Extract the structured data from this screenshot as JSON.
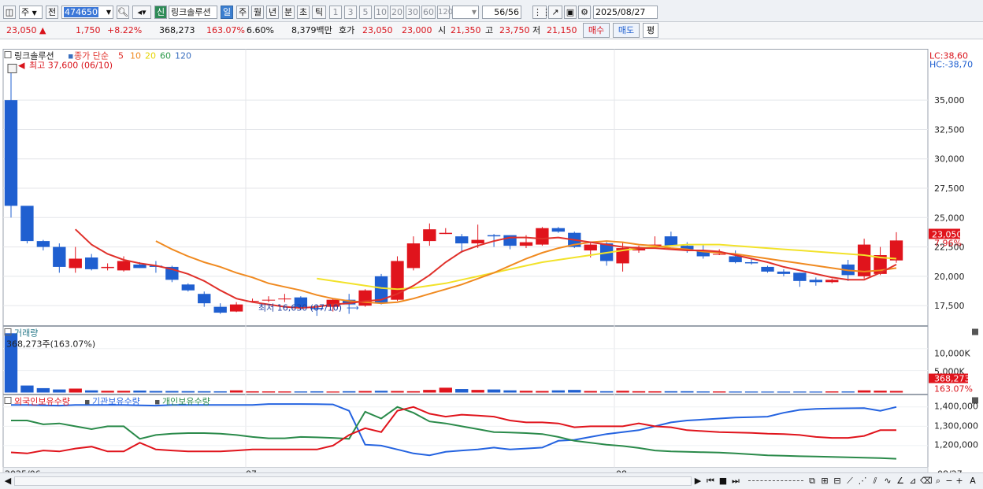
{
  "toolbar": {
    "market": "주",
    "prev_label": "전",
    "code": "474650",
    "new_badge": "신",
    "name": "링크솔루션",
    "periods": [
      "일",
      "주",
      "월",
      "년",
      "분",
      "초",
      "틱"
    ],
    "intervals": [
      "1",
      "3",
      "5",
      "10",
      "20",
      "30",
      "60",
      "120"
    ],
    "count": "56",
    "count_total": "/56",
    "date": "2025/08/27"
  },
  "quote": {
    "price": "23,050",
    "change": "1,750",
    "change_pct": "+8.22%",
    "volume": "368,273",
    "vol_ratio": "163.07%",
    "turnover": "6.60%",
    "amount": "8,379백만",
    "hoga_label": "호가",
    "ask": "23,050",
    "bid": "23,000",
    "open_label": "시",
    "open": "21,350",
    "high_label": "고",
    "high": "23,750",
    "low_label": "저",
    "low": "21,150",
    "buy_label": "매수",
    "sell_label": "매도",
    "eval_label": "평"
  },
  "price_panel": {
    "legend_name": "링크솔루션",
    "ma_legend": "종가 단순",
    "ma_periods": [
      "5",
      "10",
      "20",
      "60",
      "120"
    ],
    "ma_colors": [
      "#e0302a",
      "#f08a20",
      "#f2e22a",
      "#2d9a4a",
      "#3a6fbf"
    ],
    "lc": "LC:38,60",
    "hc": "HC:-38,70",
    "high_note": "최고 37,600 (06/10)",
    "low_note": "최저 16,630 (07/10)",
    "last_price": "23,050",
    "last_pct": "7.96%",
    "yticks": [
      "35,000",
      "32,500",
      "30,000",
      "27,500",
      "25,000",
      "22,500",
      "20,000",
      "17,500"
    ]
  },
  "volume_panel": {
    "title": "거래량",
    "info": "368,273주(163.07%)",
    "yticks": [
      "10,000K",
      "5,000K"
    ],
    "last_value": "368,273",
    "last_pct": "163.07%"
  },
  "holding_panel": {
    "series_labels": [
      "외국인보유수량",
      "기관보유수량",
      "개인보유수량"
    ],
    "series_colors": [
      "#e0141c",
      "#2463e0",
      "#2a8a4a"
    ],
    "yticks": [
      "1,400,000",
      "1,300,000",
      "1,200,000"
    ]
  },
  "xaxis": {
    "labels": [
      "2025/06",
      "07",
      "08"
    ],
    "right_label": "08/27"
  },
  "chart_data": {
    "type": "candlestick",
    "candles": [
      [
        35000,
        37600,
        25000,
        26000
      ],
      [
        26000,
        25800,
        22800,
        23000
      ],
      [
        23000,
        23100,
        22200,
        22500
      ],
      [
        22500,
        22800,
        20300,
        20800
      ],
      [
        20700,
        22500,
        20300,
        21500
      ],
      [
        21600,
        21900,
        20500,
        20600
      ],
      [
        20700,
        21100,
        20500,
        20800
      ],
      [
        20500,
        21700,
        20400,
        21300
      ],
      [
        21000,
        21200,
        20700,
        20700
      ],
      [
        20900,
        21300,
        20300,
        20800
      ],
      [
        20800,
        20900,
        19500,
        19700
      ],
      [
        19300,
        19400,
        18700,
        18800
      ],
      [
        18500,
        18700,
        17400,
        17700
      ],
      [
        17400,
        17700,
        16800,
        16900
      ],
      [
        17000,
        17800,
        16950,
        17600
      ],
      [
        17900,
        18100,
        17800,
        17900
      ],
      [
        18000,
        18300,
        17800,
        18000
      ],
      [
        18100,
        18500,
        17800,
        18100
      ],
      [
        18200,
        18300,
        17100,
        17300
      ],
      [
        17300,
        17600,
        16630,
        17200
      ],
      [
        17400,
        18100,
        17000,
        18000
      ],
      [
        18000,
        18500,
        16800,
        17600
      ],
      [
        17500,
        18900,
        17400,
        18800
      ],
      [
        20000,
        20200,
        17600,
        17700
      ],
      [
        18000,
        21700,
        17900,
        21300
      ],
      [
        20700,
        23400,
        20500,
        22800
      ],
      [
        23000,
        24500,
        22600,
        24000
      ],
      [
        23600,
        24100,
        23600,
        23700
      ],
      [
        23400,
        23600,
        22000,
        22800
      ],
      [
        22800,
        24400,
        22400,
        23100
      ],
      [
        23500,
        23600,
        22500,
        23400
      ],
      [
        23500,
        23400,
        22300,
        22600
      ],
      [
        22600,
        23500,
        22400,
        22900
      ],
      [
        22700,
        24200,
        22600,
        24100
      ],
      [
        24100,
        24200,
        23700,
        23800
      ],
      [
        23700,
        23800,
        22400,
        22500
      ],
      [
        22200,
        22900,
        21600,
        22700
      ],
      [
        22800,
        22900,
        20900,
        21300
      ],
      [
        21100,
        22900,
        20400,
        22400
      ],
      [
        22200,
        22600,
        22000,
        22500
      ],
      [
        22600,
        23400,
        22400,
        22700
      ],
      [
        23400,
        23800,
        22600,
        22600
      ],
      [
        22600,
        22900,
        22000,
        22300
      ],
      [
        22200,
        22700,
        21500,
        21700
      ],
      [
        21900,
        22300,
        21800,
        21900
      ],
      [
        21700,
        22200,
        21100,
        21200
      ],
      [
        21200,
        21500,
        21000,
        21100
      ],
      [
        20800,
        20900,
        20300,
        20400
      ],
      [
        20400,
        20600,
        20000,
        20200
      ],
      [
        20300,
        20300,
        19100,
        19600
      ],
      [
        19700,
        19900,
        19200,
        19500
      ],
      [
        19500,
        19800,
        19400,
        19700
      ],
      [
        21000,
        21400,
        19600,
        20100
      ],
      [
        20000,
        23200,
        19800,
        22700
      ],
      [
        20200,
        22500,
        20100,
        21800
      ],
      [
        21350,
        23750,
        21150,
        23050
      ]
    ],
    "ma5": [
      null,
      null,
      null,
      null,
      24000,
      22700,
      21900,
      21400,
      21100,
      20900,
      20600,
      20200,
      19600,
      18800,
      18100,
      17800,
      17600,
      17400,
      17300,
      17400,
      17600,
      17700,
      17900,
      18000,
      18500,
      19200,
      20100,
      21200,
      22100,
      22600,
      23000,
      23300,
      23300,
      23200,
      23300,
      23100,
      22900,
      22700,
      22500,
      22400,
      22400,
      22300,
      22200,
      22200,
      22100,
      21800,
      21500,
      21200,
      20800,
      20500,
      20200,
      19900,
      19700,
      19700,
      20300,
      21000
    ],
    "ma10": [
      null,
      null,
      null,
      null,
      null,
      null,
      null,
      null,
      null,
      23000,
      22300,
      21700,
      21200,
      20800,
      20300,
      19900,
      19400,
      19100,
      18800,
      18400,
      18100,
      17900,
      17800,
      17700,
      17800,
      18100,
      18500,
      18900,
      19300,
      19800,
      20300,
      20900,
      21500,
      22000,
      22400,
      22700,
      22900,
      23000,
      22900,
      22700,
      22600,
      22400,
      22300,
      22100,
      22000,
      21900,
      21700,
      21500,
      21300,
      21100,
      20900,
      20700,
      20500,
      20400,
      20500,
      20700
    ],
    "ma20": [
      null,
      null,
      null,
      null,
      null,
      null,
      null,
      null,
      null,
      null,
      null,
      null,
      null,
      null,
      null,
      null,
      null,
      null,
      null,
      19800,
      19600,
      19400,
      19200,
      19000,
      18900,
      19000,
      19200,
      19400,
      19700,
      20000,
      20300,
      20600,
      20900,
      21200,
      21400,
      21600,
      21800,
      22000,
      22200,
      22400,
      22500,
      22600,
      22700,
      22700,
      22700,
      22600,
      22500,
      22400,
      22300,
      22200,
      22100,
      22000,
      21900,
      21800,
      21600,
      21500
    ],
    "volume_k": [
      13500,
      1600,
      1000,
      700,
      900,
      500,
      400,
      400,
      450,
      350,
      350,
      320,
      300,
      280,
      500,
      280,
      260,
      250,
      250,
      280,
      230,
      300,
      350,
      400,
      350,
      300,
      600,
      1100,
      800,
      600,
      700,
      500,
      400,
      350,
      500,
      600,
      350,
      300,
      400,
      300,
      280,
      300,
      300,
      250,
      250,
      230,
      230,
      220,
      220,
      230,
      220,
      260,
      250,
      500,
      420,
      368
    ],
    "foreign": [
      1165000,
      1160000,
      1175000,
      1170000,
      1185000,
      1195000,
      1170000,
      1170000,
      1215000,
      1180000,
      1175000,
      1170000,
      1170000,
      1170000,
      1175000,
      1180000,
      1180000,
      1180000,
      1180000,
      1180000,
      1200000,
      1255000,
      1290000,
      1270000,
      1380000,
      1400000,
      1365000,
      1350000,
      1360000,
      1355000,
      1350000,
      1330000,
      1320000,
      1320000,
      1315000,
      1295000,
      1300000,
      1300000,
      1300000,
      1315000,
      1300000,
      1295000,
      1280000,
      1275000,
      1270000,
      1268000,
      1266000,
      1262000,
      1260000,
      1255000,
      1245000,
      1240000,
      1240000,
      1250000,
      1280000,
      1280000
    ],
    "institution": [
      1410000,
      1410000,
      1408000,
      1407000,
      1410000,
      1410000,
      1410000,
      1410000,
      1408000,
      1407000,
      1410000,
      1410000,
      1410000,
      1410000,
      1410000,
      1410000,
      1415000,
      1415000,
      1415000,
      1414000,
      1413000,
      1380000,
      1205000,
      1200000,
      1180000,
      1160000,
      1150000,
      1168000,
      1175000,
      1180000,
      1190000,
      1180000,
      1185000,
      1190000,
      1225000,
      1230000,
      1245000,
      1260000,
      1270000,
      1280000,
      1300000,
      1320000,
      1330000,
      1335000,
      1340000,
      1345000,
      1347000,
      1350000,
      1370000,
      1385000,
      1390000,
      1392000,
      1393000,
      1394000,
      1380000,
      1400000
    ],
    "individual": [
      1330000,
      1330000,
      1310000,
      1315000,
      1300000,
      1285000,
      1300000,
      1300000,
      1235000,
      1255000,
      1262000,
      1265000,
      1265000,
      1262000,
      1255000,
      1245000,
      1238000,
      1238000,
      1245000,
      1243000,
      1240000,
      1235000,
      1375000,
      1340000,
      1400000,
      1370000,
      1325000,
      1315000,
      1300000,
      1285000,
      1270000,
      1268000,
      1265000,
      1260000,
      1245000,
      1225000,
      1215000,
      1205000,
      1198000,
      1188000,
      1175000,
      1170000,
      1168000,
      1166000,
      1164000,
      1160000,
      1155000,
      1150000,
      1148000,
      1145000,
      1144000,
      1142000,
      1140000,
      1138000,
      1136000,
      1132000
    ],
    "ylim_price": [
      16000,
      38800
    ],
    "ylim_volume_k": [
      0,
      14000
    ],
    "ylim_holding": [
      1100000,
      1450000
    ]
  }
}
